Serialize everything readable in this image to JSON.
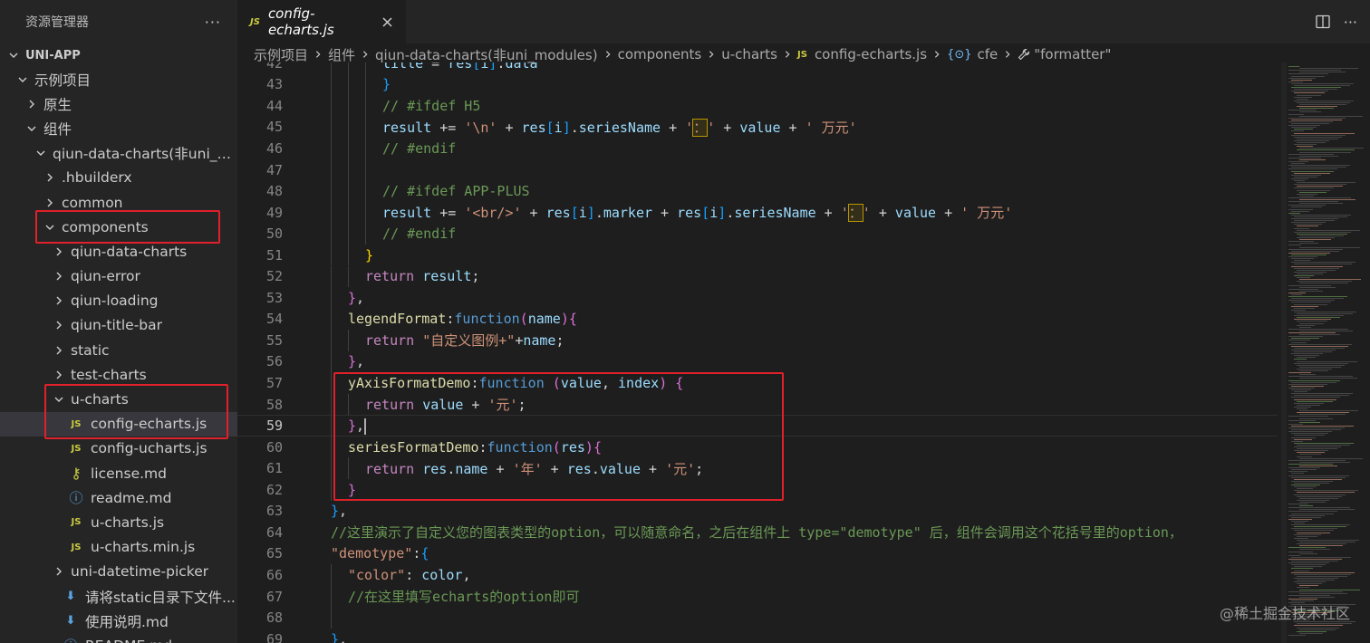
{
  "sidebar": {
    "title": "资源管理器",
    "more": "···",
    "section": "UNI-APP",
    "items": [
      {
        "label": "示例项目",
        "indent": 1,
        "type": "folder-open"
      },
      {
        "label": "原生",
        "indent": 2,
        "type": "folder"
      },
      {
        "label": "组件",
        "indent": 2,
        "type": "folder-open"
      },
      {
        "label": "qiun-data-charts(非uni_m...",
        "indent": 3,
        "type": "folder-open"
      },
      {
        "label": ".hbuilderx",
        "indent": 4,
        "type": "folder"
      },
      {
        "label": "common",
        "indent": 4,
        "type": "folder"
      },
      {
        "label": "components",
        "indent": 4,
        "type": "folder-open"
      },
      {
        "label": "qiun-data-charts",
        "indent": 5,
        "type": "folder"
      },
      {
        "label": "qiun-error",
        "indent": 5,
        "type": "folder"
      },
      {
        "label": "qiun-loading",
        "indent": 5,
        "type": "folder"
      },
      {
        "label": "qiun-title-bar",
        "indent": 5,
        "type": "folder"
      },
      {
        "label": "static",
        "indent": 5,
        "type": "folder"
      },
      {
        "label": "test-charts",
        "indent": 5,
        "type": "folder"
      },
      {
        "label": "u-charts",
        "indent": 5,
        "type": "folder-open"
      },
      {
        "label": "config-echarts.js",
        "indent": 6,
        "type": "js",
        "selected": true
      },
      {
        "label": "config-ucharts.js",
        "indent": 6,
        "type": "js"
      },
      {
        "label": "license.md",
        "indent": 6,
        "type": "key"
      },
      {
        "label": "readme.md",
        "indent": 6,
        "type": "info"
      },
      {
        "label": "u-charts.js",
        "indent": 6,
        "type": "js"
      },
      {
        "label": "u-charts.min.js",
        "indent": 6,
        "type": "js"
      },
      {
        "label": "uni-datetime-picker",
        "indent": 5,
        "type": "folder"
      },
      {
        "label": "请将static目录下文件...",
        "indent": 5,
        "type": "download"
      },
      {
        "label": "使用说明.md",
        "indent": 5,
        "type": "download"
      },
      {
        "label": "README.md",
        "indent": 5,
        "type": "info"
      }
    ]
  },
  "tab": {
    "icon": "JS",
    "label": "config-echarts.js"
  },
  "breadcrumb": {
    "parts": [
      "示例项目",
      "组件",
      "qiun-data-charts(非uni_modules)",
      "components",
      "u-charts"
    ],
    "file_icon": "JS",
    "file": "config-echarts.js",
    "symbol": "cfe",
    "property": "\"formatter\""
  },
  "code": {
    "active_line": 59,
    "lines": [
      {
        "n": 42,
        "indent": 4,
        "tokens": [
          [
            "t-var",
            "title"
          ],
          [
            "",
            " = "
          ],
          [
            "t-var",
            "res"
          ],
          [
            "t-p3",
            "["
          ],
          [
            "t-var",
            "i"
          ],
          [
            "t-p3",
            "]"
          ],
          [
            "",
            "."
          ],
          [
            "t-var",
            "data"
          ]
        ]
      },
      {
        "n": 43,
        "indent": 4,
        "tokens": [
          [
            "t-p3",
            "}"
          ]
        ]
      },
      {
        "n": 44,
        "indent": 4,
        "tokens": [
          [
            "t-cmt",
            "// #ifdef H5"
          ]
        ]
      },
      {
        "n": 45,
        "indent": 4,
        "tokens": [
          [
            "t-var",
            "result"
          ],
          [
            "",
            " += "
          ],
          [
            "t-str",
            "'\\n'"
          ],
          [
            "",
            " + "
          ],
          [
            "t-var",
            "res"
          ],
          [
            "t-p3",
            "["
          ],
          [
            "t-var",
            "i"
          ],
          [
            "t-p3",
            "]"
          ],
          [
            "",
            "."
          ],
          [
            "t-var",
            "seriesName"
          ],
          [
            "",
            " + "
          ],
          [
            "t-str",
            "'"
          ],
          [
            "t-str t-hl",
            "："
          ],
          [
            "t-str",
            "'"
          ],
          [
            "",
            " + "
          ],
          [
            "t-var",
            "value"
          ],
          [
            "",
            " + "
          ],
          [
            "t-str",
            "' 万元'"
          ]
        ]
      },
      {
        "n": 46,
        "indent": 4,
        "tokens": [
          [
            "t-cmt",
            "// #endif"
          ]
        ]
      },
      {
        "n": 47,
        "indent": 4,
        "tokens": []
      },
      {
        "n": 48,
        "indent": 4,
        "tokens": [
          [
            "t-cmt",
            "// #ifdef APP-PLUS"
          ]
        ]
      },
      {
        "n": 49,
        "indent": 4,
        "tokens": [
          [
            "t-var",
            "result"
          ],
          [
            "",
            " += "
          ],
          [
            "t-str",
            "'<br/>'"
          ],
          [
            "",
            " + "
          ],
          [
            "t-var",
            "res"
          ],
          [
            "t-p3",
            "["
          ],
          [
            "t-var",
            "i"
          ],
          [
            "t-p3",
            "]"
          ],
          [
            "",
            "."
          ],
          [
            "t-var",
            "marker"
          ],
          [
            "",
            " + "
          ],
          [
            "t-var",
            "res"
          ],
          [
            "t-p3",
            "["
          ],
          [
            "t-var",
            "i"
          ],
          [
            "t-p3",
            "]"
          ],
          [
            "",
            "."
          ],
          [
            "t-var",
            "seriesName"
          ],
          [
            "",
            " + "
          ],
          [
            "t-str",
            "'"
          ],
          [
            "t-str t-hl",
            "："
          ],
          [
            "t-str",
            "'"
          ],
          [
            "",
            " + "
          ],
          [
            "t-var",
            "value"
          ],
          [
            "",
            " + "
          ],
          [
            "t-str",
            "' 万元'"
          ]
        ]
      },
      {
        "n": 50,
        "indent": 4,
        "tokens": [
          [
            "t-cmt",
            "// #endif"
          ]
        ]
      },
      {
        "n": 51,
        "indent": 3,
        "tokens": [
          [
            "t-p1",
            "}"
          ]
        ]
      },
      {
        "n": 52,
        "indent": 3,
        "tokens": [
          [
            "t-ctl",
            "return"
          ],
          [
            "",
            " "
          ],
          [
            "t-var",
            "result"
          ],
          [
            "",
            ";"
          ]
        ]
      },
      {
        "n": 53,
        "indent": 2,
        "tokens": [
          [
            "t-p2",
            "}"
          ],
          [
            "",
            ","
          ]
        ]
      },
      {
        "n": 54,
        "indent": 2,
        "tokens": [
          [
            "t-fn",
            "legendFormat"
          ],
          [
            "",
            ":"
          ],
          [
            "t-kw",
            "function"
          ],
          [
            "t-p2",
            "("
          ],
          [
            "t-var",
            "name"
          ],
          [
            "t-p2",
            ")"
          ],
          [
            "t-p2",
            "{"
          ]
        ]
      },
      {
        "n": 55,
        "indent": 3,
        "tokens": [
          [
            "t-ctl",
            "return"
          ],
          [
            "",
            " "
          ],
          [
            "t-str",
            "\"自定义图例+\""
          ],
          [
            "",
            "+"
          ],
          [
            "t-var",
            "name"
          ],
          [
            "",
            ";"
          ]
        ]
      },
      {
        "n": 56,
        "indent": 2,
        "tokens": [
          [
            "t-p2",
            "}"
          ],
          [
            "",
            ","
          ]
        ]
      },
      {
        "n": 57,
        "indent": 2,
        "tokens": [
          [
            "t-fn",
            "yAxisFormatDemo"
          ],
          [
            "",
            ":"
          ],
          [
            "t-kw",
            "function"
          ],
          [
            "",
            " "
          ],
          [
            "t-p2",
            "("
          ],
          [
            "t-var",
            "value"
          ],
          [
            "",
            ", "
          ],
          [
            "t-var",
            "index"
          ],
          [
            "t-p2",
            ")"
          ],
          [
            "",
            " "
          ],
          [
            "t-p2",
            "{"
          ]
        ]
      },
      {
        "n": 58,
        "indent": 3,
        "tokens": [
          [
            "t-ctl",
            "return"
          ],
          [
            "",
            " "
          ],
          [
            "t-var",
            "value"
          ],
          [
            "",
            " + "
          ],
          [
            "t-str",
            "'元'"
          ],
          [
            "",
            ";"
          ]
        ]
      },
      {
        "n": 59,
        "indent": 2,
        "tokens": [
          [
            "t-p2",
            "}"
          ],
          [
            "",
            ","
          ]
        ]
      },
      {
        "n": 60,
        "indent": 2,
        "tokens": [
          [
            "t-fn",
            "seriesFormatDemo"
          ],
          [
            "",
            ":"
          ],
          [
            "t-kw",
            "function"
          ],
          [
            "t-p2",
            "("
          ],
          [
            "t-var",
            "res"
          ],
          [
            "t-p2",
            ")"
          ],
          [
            "t-p2",
            "{"
          ]
        ]
      },
      {
        "n": 61,
        "indent": 3,
        "tokens": [
          [
            "t-ctl",
            "return"
          ],
          [
            "",
            " "
          ],
          [
            "t-var",
            "res"
          ],
          [
            "",
            "."
          ],
          [
            "t-var",
            "name"
          ],
          [
            "",
            " + "
          ],
          [
            "t-str",
            "'年'"
          ],
          [
            "",
            " + "
          ],
          [
            "t-var",
            "res"
          ],
          [
            "",
            "."
          ],
          [
            "t-var",
            "value"
          ],
          [
            "",
            " + "
          ],
          [
            "t-str",
            "'元'"
          ],
          [
            "",
            ";"
          ]
        ]
      },
      {
        "n": 62,
        "indent": 2,
        "tokens": [
          [
            "t-p2",
            "}"
          ]
        ]
      },
      {
        "n": 63,
        "indent": 1,
        "tokens": [
          [
            "t-p3",
            "}"
          ],
          [
            "",
            ","
          ]
        ]
      },
      {
        "n": 64,
        "indent": 1,
        "tokens": [
          [
            "t-cmt",
            "//这里演示了自定义您的图表类型的option，可以随意命名，之后在组件上 type=\"demotype\" 后，组件会调用这个花括号里的option，"
          ]
        ]
      },
      {
        "n": 65,
        "indent": 1,
        "tokens": [
          [
            "t-str",
            "\"demotype\""
          ],
          [
            "",
            ":"
          ],
          [
            "t-p3",
            "{"
          ]
        ]
      },
      {
        "n": 66,
        "indent": 2,
        "tokens": [
          [
            "t-str",
            "\"color\""
          ],
          [
            "",
            ": "
          ],
          [
            "t-var",
            "color"
          ],
          [
            "",
            ","
          ]
        ]
      },
      {
        "n": 67,
        "indent": 2,
        "tokens": [
          [
            "t-cmt",
            "//在这里填写echarts的option即可"
          ]
        ]
      },
      {
        "n": 68,
        "indent": 2,
        "tokens": []
      },
      {
        "n": 69,
        "indent": 1,
        "tokens": [
          [
            "t-p3",
            "}"
          ],
          [
            "",
            ","
          ]
        ]
      }
    ]
  },
  "watermark": "@稀土掘金技术社区",
  "colors": {
    "highlight_box": "#e0202a",
    "accent_js": "#cbcb41"
  }
}
